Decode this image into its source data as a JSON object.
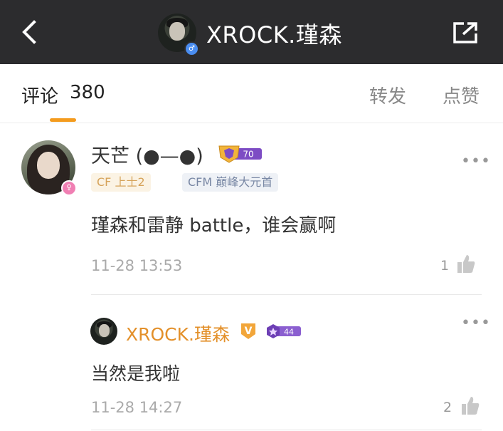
{
  "header": {
    "title": "XROCK.瑾森",
    "back_icon": "chevron-left-icon",
    "share_icon": "share-icon",
    "gender_icon": "male-icon"
  },
  "tabs": {
    "comments_label": "评论",
    "comments_count": "380",
    "repost_label": "转发",
    "like_label": "点赞",
    "active_color": "#f49b1d"
  },
  "comment": {
    "user_name": "天芒 (●—●)",
    "level": "70",
    "gender_icon": "female-icon",
    "tags": [
      "CF 上士2",
      "CFM 巅峰大元首"
    ],
    "text": "瑾森和雷静 battle，谁会赢啊",
    "time": "11-28 13:53",
    "like_count": "1"
  },
  "reply": {
    "user_name": "XROCK.瑾森",
    "verified": "V",
    "level": "44",
    "text": "当然是我啦",
    "time": "11-28 14:27",
    "like_count": "2"
  }
}
